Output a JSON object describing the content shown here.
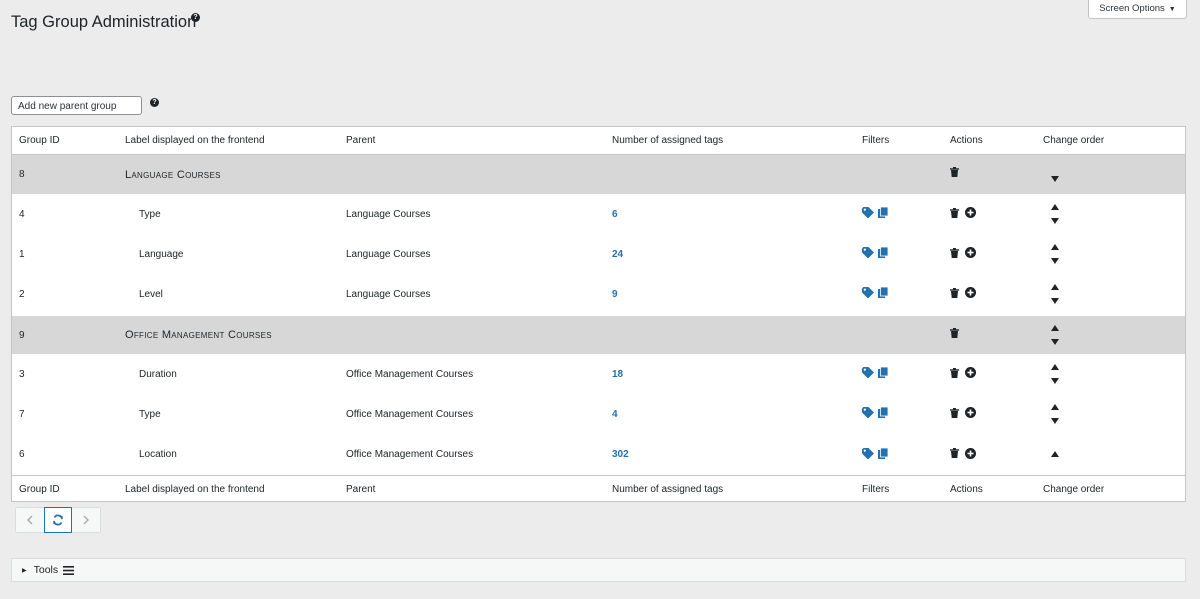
{
  "page": {
    "title": "Tag Group Administration",
    "screen_options": "Screen Options"
  },
  "new_parent_input": {
    "value": "Add new parent group"
  },
  "columns": {
    "id": "Group ID",
    "label": "Label displayed on the frontend",
    "parent": "Parent",
    "count": "Number of assigned tags",
    "filters": "Filters",
    "actions": "Actions",
    "order": "Change order"
  },
  "rows": [
    {
      "type": "parent",
      "id": "8",
      "label": "Language Courses",
      "parent": "",
      "count": "",
      "up": false,
      "down": true
    },
    {
      "type": "child",
      "id": "4",
      "label": "Type",
      "parent": "Language Courses",
      "count": "6",
      "up": true,
      "down": true
    },
    {
      "type": "child",
      "id": "1",
      "label": "Language",
      "parent": "Language Courses",
      "count": "24",
      "up": true,
      "down": true
    },
    {
      "type": "child",
      "id": "2",
      "label": "Level",
      "parent": "Language Courses",
      "count": "9",
      "up": true,
      "down": true
    },
    {
      "type": "parent",
      "id": "9",
      "label": "Office Management Courses",
      "parent": "",
      "count": "",
      "up": true,
      "down": true
    },
    {
      "type": "child",
      "id": "3",
      "label": "Duration",
      "parent": "Office Management Courses",
      "count": "18",
      "up": true,
      "down": true
    },
    {
      "type": "child",
      "id": "7",
      "label": "Type",
      "parent": "Office Management Courses",
      "count": "4",
      "up": true,
      "down": true
    },
    {
      "type": "child",
      "id": "6",
      "label": "Location",
      "parent": "Office Management Courses",
      "count": "302",
      "up": true,
      "down": false
    }
  ],
  "tools": {
    "label": "Tools"
  },
  "colors": {
    "accent": "#2271b1",
    "parent_row_bg": "#d7d7d7",
    "page_bg": "#ececec"
  },
  "icons": {
    "filter_tag": "tag-icon",
    "filter_posts": "posts-icon",
    "delete": "trash-icon",
    "add": "plus-circle-icon"
  }
}
